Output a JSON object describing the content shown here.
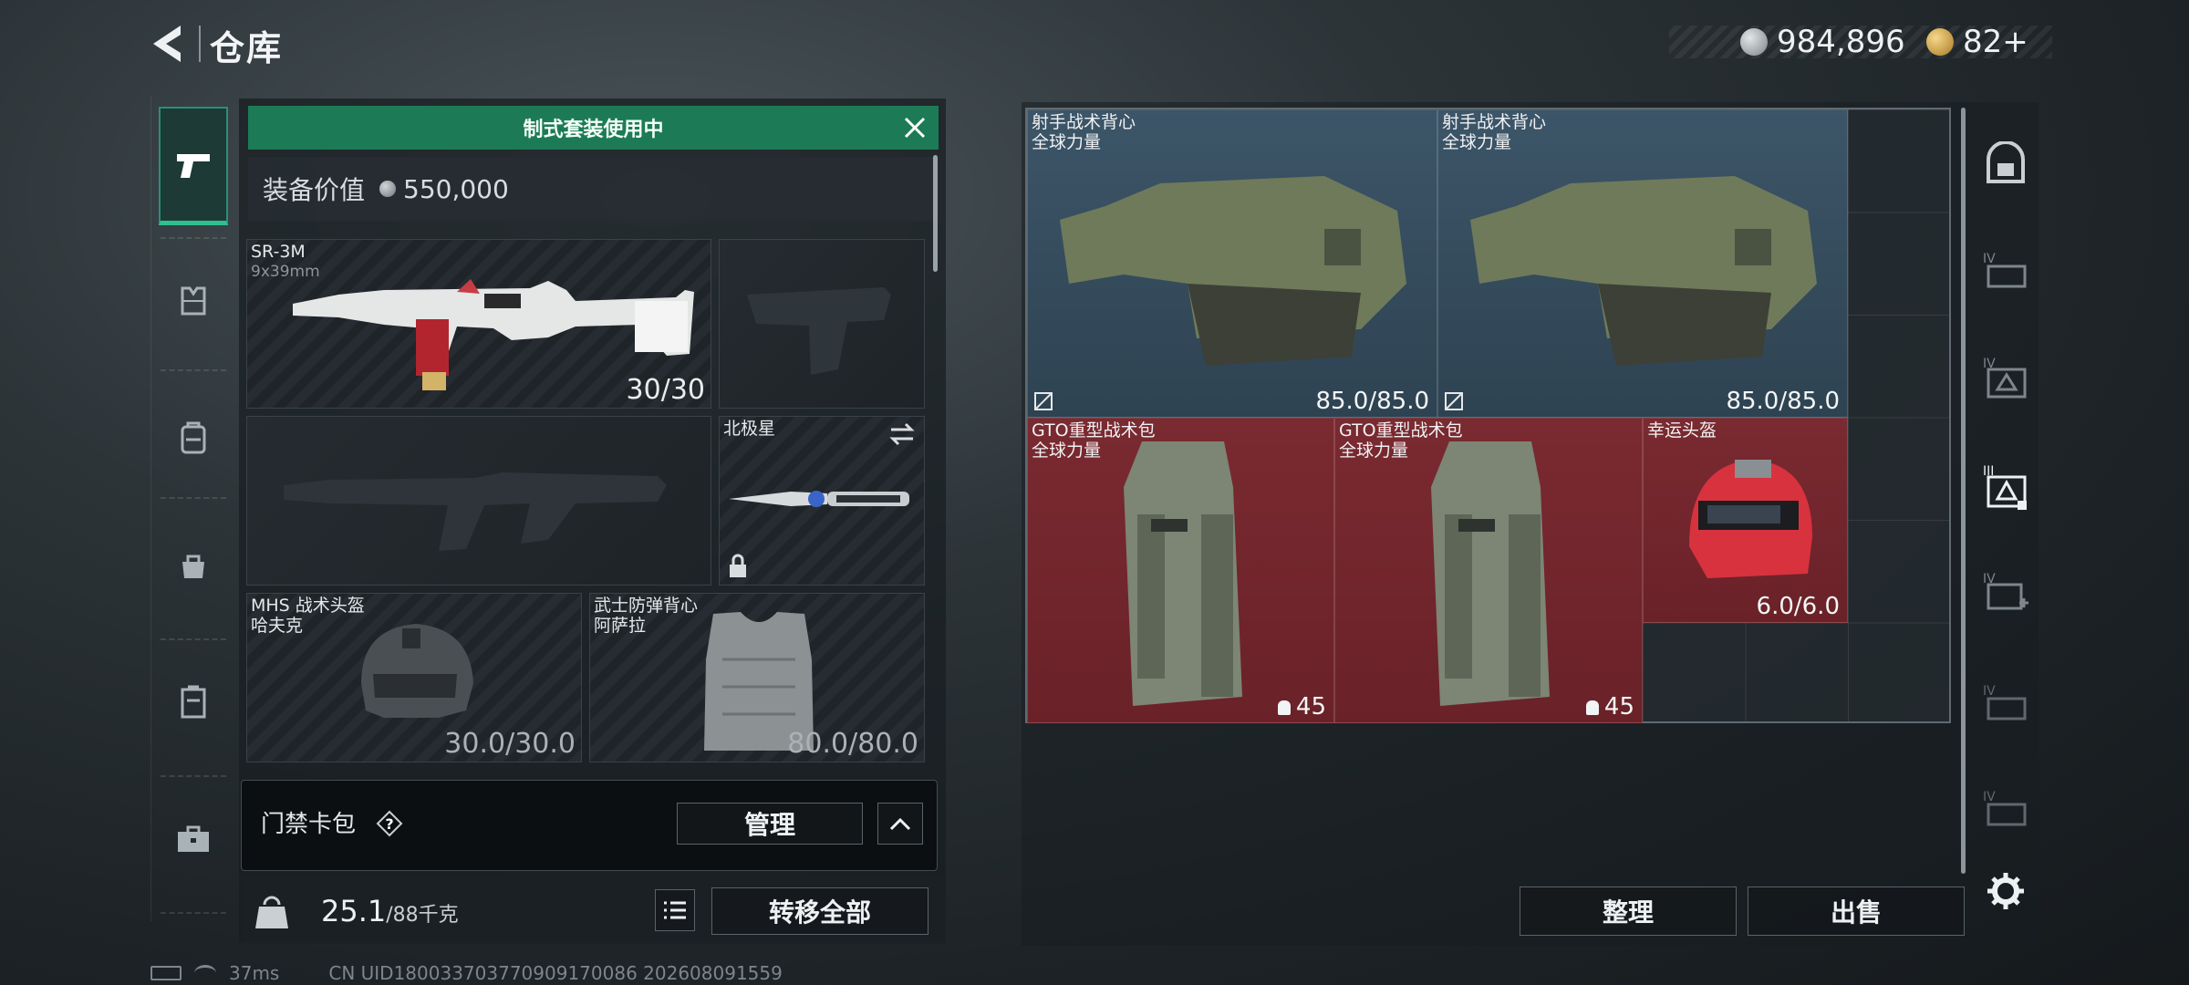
{
  "header": {
    "title": "仓库",
    "currency1": "984,896",
    "currency2": "82+"
  },
  "loadout": {
    "banner": "制式套装使用中",
    "value_label": "装备价值",
    "value": "550,000",
    "slots": {
      "primary": {
        "name": "SR-3M",
        "ammo": "9x39mm",
        "count": "30/30"
      },
      "melee": {
        "name": "北极星"
      },
      "helmet": {
        "name": "MHS 战术头盔",
        "sub": "哈夫克",
        "durability": "30.0/30.0"
      },
      "armor": {
        "name": "武士防弹背心",
        "sub": "阿萨拉",
        "durability": "80.0/80.0"
      }
    },
    "card_pack_label": "门禁卡包",
    "manage_button": "管理",
    "weight_value": "25.1",
    "weight_max": "/88千克",
    "transfer_all_button": "转移全部"
  },
  "inventory": {
    "items": [
      {
        "name": "射手战术背心",
        "sub": "全球力量",
        "durability": "85.0/85.0",
        "color": "#3c5568"
      },
      {
        "name": "射手战术背心",
        "sub": "全球力量",
        "durability": "85.0/85.0",
        "color": "#3c5568"
      },
      {
        "name": "GTO重型战术包",
        "sub": "全球力量",
        "capacity": "45",
        "color": "#7a2a31"
      },
      {
        "name": "GTO重型战术包",
        "sub": "全球力量",
        "capacity": "45",
        "color": "#7a2a31"
      },
      {
        "name": "幸运头盔",
        "durability": "6.0/6.0",
        "color": "#7a2a31"
      }
    ],
    "sort_button": "整理",
    "sell_button": "出售"
  },
  "status": {
    "ping": "37ms",
    "uid": "CN UID180033703770909170086 202608091559"
  },
  "icons": [
    "back-arrow-icon",
    "silver-coin-icon",
    "gold-coin-icon",
    "gun-icon",
    "vest-icon",
    "backpack-icon",
    "bag-icon",
    "container-icon",
    "briefcase-icon",
    "close-icon",
    "swap-icon",
    "lock-icon",
    "help-icon",
    "chevron-up-icon",
    "list-icon",
    "safe-box-icon",
    "settings-gear-icon"
  ]
}
